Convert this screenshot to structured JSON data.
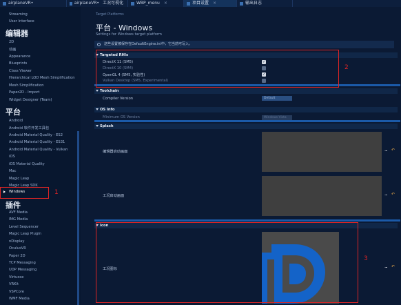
{
  "tabs": [
    {
      "label": "airplaneVR•",
      "active": false
    },
    {
      "label": "airplaneVR•",
      "active": false
    },
    {
      "label": "工况可视化",
      "active": false
    },
    {
      "label": "WBP_menu",
      "active": false
    },
    {
      "label": "项目设置",
      "active": true
    },
    {
      "label": "输出日志",
      "active": false
    }
  ],
  "sidebar": {
    "top_items": [
      "Streaming",
      "User Interface"
    ],
    "editor_header": "编辑器",
    "editor_items": [
      "2D",
      "动画",
      "Appearance",
      "Blueprints",
      "Class Viewer",
      "Hierarchical LOD Mesh Simplification",
      "Mesh Simplification",
      "Paper2D - Import",
      "Widget Designer (Team)"
    ],
    "platform_header": "平台",
    "platform_items": [
      "Android",
      "Android 软件开发工具包",
      "Android Material Quality - ES2",
      "Android Material Quality - ES31",
      "Android Material Quality - Vulkan",
      "iOS",
      "iOS Material Quality",
      "Mac",
      "Magic Leap",
      "Magic Leap SDK",
      "Windows"
    ],
    "plugin_header": "插件",
    "plugin_items": [
      "AVF Media",
      "IMG Media",
      "Level Sequencer",
      "Magic Leap Plugin",
      "nDisplay",
      "OculusVR",
      "Paper 2D",
      "TCP Messaging",
      "UDP Messaging",
      "Virtuose",
      "VRKit",
      "VSPCore",
      "WMF Media"
    ]
  },
  "main": {
    "breadcrumb": "Target Platforms",
    "title": "平台 - Windows",
    "subtitle": "Settings for Windows target platform",
    "notice": "这些设置被保存在DefaultEngine.ini中，它当前可写入。",
    "rhis": {
      "header": "Targeted RHIs",
      "items": [
        {
          "label": "DirectX 11 (SM5)",
          "checked": true,
          "enabled": true
        },
        {
          "label": "DirectX 10 (SM4)",
          "checked": false,
          "enabled": false
        },
        {
          "label": "OpenGL 4 (SM5, 实验性)",
          "checked": true,
          "enabled": true
        },
        {
          "label": "Vulkan Desktop (SM5, Experimental)",
          "checked": false,
          "enabled": false
        }
      ]
    },
    "toolchain": {
      "header": "Toolchain",
      "label": "Compiler Version",
      "value": "Default"
    },
    "osinfo": {
      "header": "OS Info",
      "label": "Minimum OS Version",
      "value": "Windows Vista"
    },
    "splash": {
      "header": "Splash",
      "editor_label": "编辑器启动画面",
      "game_label": "工况启动画面"
    },
    "icon": {
      "header": "Icon",
      "label": "工况图标"
    },
    "dots": "...",
    "reset": "↶"
  },
  "annotations": [
    "1",
    "2",
    "3"
  ],
  "colors": {
    "annotation": "#e02525",
    "reset": "#e3a64a",
    "logo_blue": "#1463c8"
  }
}
